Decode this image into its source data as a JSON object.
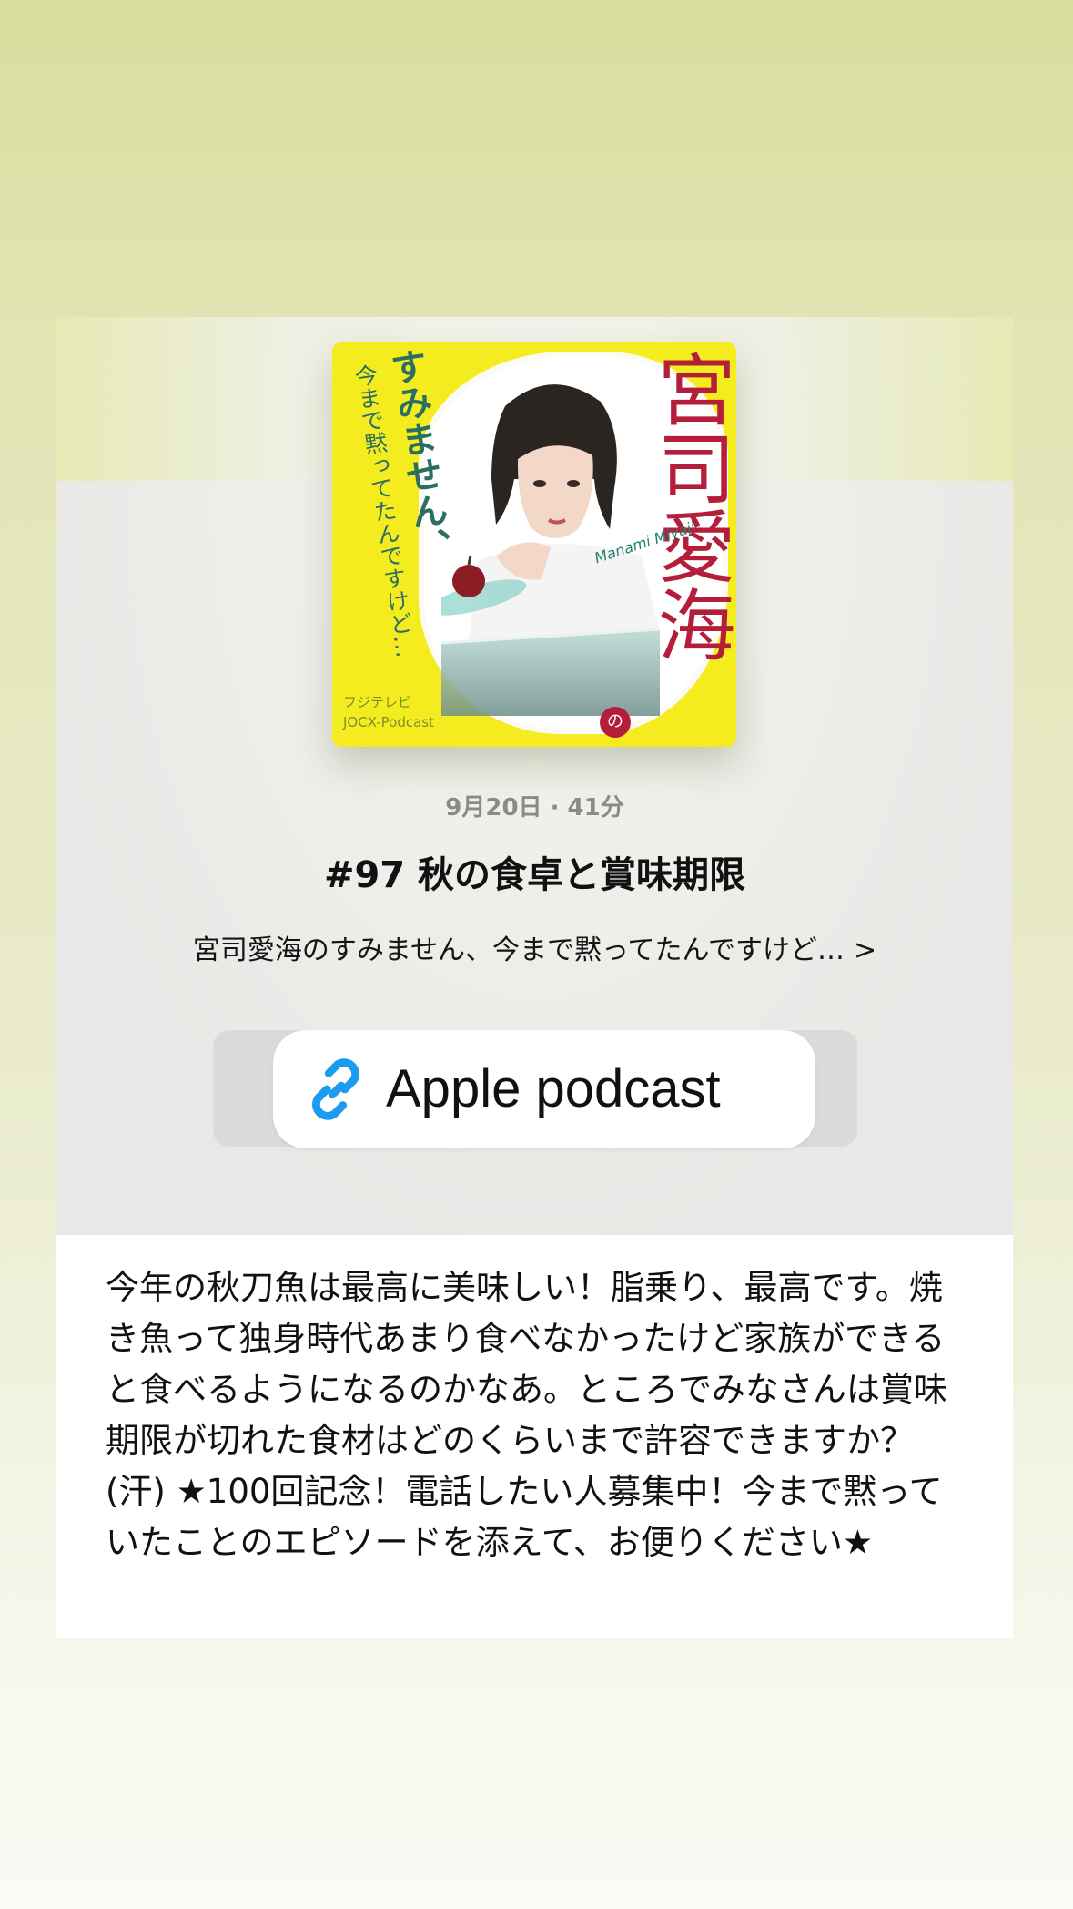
{
  "card": {
    "date_duration": "9月20日 · 41分",
    "episode_title": "#97 秋の食卓と賞味期限",
    "show_name": "宮司愛海のすみません、今まで黙ってたんですけど…",
    "show_chevron": ">"
  },
  "artwork": {
    "title_vertical": "宮司愛海",
    "subtitle_big": "すみません、",
    "subtitle_small": "今まで黙ってたんですけど…",
    "name_en": "Manami Miyaji",
    "logo_line1": "フジテレビ",
    "logo_line2": "JOCX-Podcast",
    "no_char": "の"
  },
  "link_sticker": {
    "icon": "link-icon",
    "label": "Apple podcast"
  },
  "description": {
    "text": "今年の秋刀魚は最高に美味しい！脂乗り、最高です。焼き魚って独身時代あまり食べなかったけど家族ができると食べるようになるのかなあ。ところでみなさんは賞味期限が切れた食材はどのくらいまで許容できますか？(汗) ★100回記念！電話したい人募集中！今まで黙っていたことのエピソードを添えて、お便りください★"
  },
  "colors": {
    "background_top": "#d9dd9c",
    "background_bottom": "#fbfbf6",
    "artwork_yellow": "#f5ec1f",
    "artwork_green": "#25806f",
    "artwork_red": "#b41e3a",
    "link_blue": "#1d9bf0"
  }
}
